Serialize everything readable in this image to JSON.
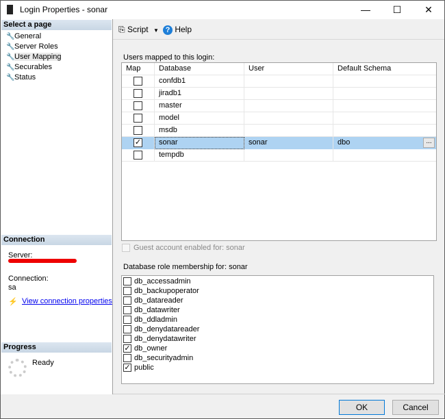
{
  "window": {
    "title": "Login Properties - sonar",
    "minimize": "—",
    "maximize": "☐",
    "close": "✕"
  },
  "left": {
    "select_page_header": "Select a page",
    "pages": [
      {
        "label": "General"
      },
      {
        "label": "Server Roles"
      },
      {
        "label": "User Mapping",
        "selected": true
      },
      {
        "label": "Securables"
      },
      {
        "label": "Status"
      }
    ],
    "connection_header": "Connection",
    "server_label": "Server:",
    "connection_label": "Connection:",
    "connection_value": "sa",
    "view_connection_link": "View connection properties",
    "progress_header": "Progress",
    "progress_status": "Ready"
  },
  "toolbar": {
    "script_label": "Script",
    "help_label": "Help"
  },
  "mapping": {
    "label": "Users mapped to this login:",
    "columns": [
      "Map",
      "Database",
      "User",
      "Default Schema"
    ],
    "rows": [
      {
        "map": false,
        "database": "confdb1",
        "user": "",
        "schema": ""
      },
      {
        "map": false,
        "database": "jiradb1",
        "user": "",
        "schema": ""
      },
      {
        "map": false,
        "database": "master",
        "user": "",
        "schema": ""
      },
      {
        "map": false,
        "database": "model",
        "user": "",
        "schema": ""
      },
      {
        "map": false,
        "database": "msdb",
        "user": "",
        "schema": ""
      },
      {
        "map": true,
        "database": "sonar",
        "user": "sonar",
        "schema": "dbo",
        "selected": true
      },
      {
        "map": false,
        "database": "tempdb",
        "user": "",
        "schema": ""
      }
    ],
    "browse_button": "..."
  },
  "guest_label": "Guest account enabled for: sonar",
  "roles": {
    "label": "Database role membership for: sonar",
    "items": [
      {
        "name": "db_accessadmin",
        "checked": false
      },
      {
        "name": "db_backupoperator",
        "checked": false
      },
      {
        "name": "db_datareader",
        "checked": false
      },
      {
        "name": "db_datawriter",
        "checked": false
      },
      {
        "name": "db_ddladmin",
        "checked": false
      },
      {
        "name": "db_denydatareader",
        "checked": false
      },
      {
        "name": "db_denydatawriter",
        "checked": false
      },
      {
        "name": "db_owner",
        "checked": true
      },
      {
        "name": "db_securityadmin",
        "checked": false
      },
      {
        "name": "public",
        "checked": true
      }
    ]
  },
  "buttons": {
    "ok": "OK",
    "cancel": "Cancel"
  }
}
